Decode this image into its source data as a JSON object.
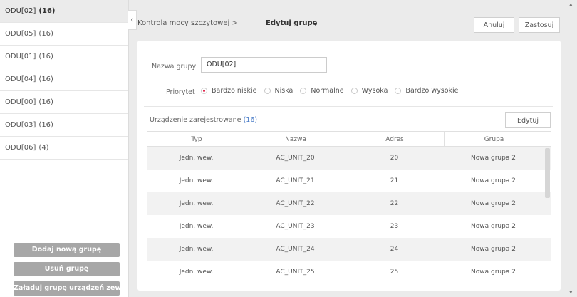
{
  "sidebar": {
    "groups": [
      {
        "name": "ODU[02]",
        "count": "(16)",
        "active": true
      },
      {
        "name": "ODU[05]",
        "count": "(16)",
        "active": false
      },
      {
        "name": "ODU[01]",
        "count": "(16)",
        "active": false
      },
      {
        "name": "ODU[04]",
        "count": "(16)",
        "active": false
      },
      {
        "name": "ODU[00]",
        "count": "(16)",
        "active": false
      },
      {
        "name": "ODU[03]",
        "count": "(16)",
        "active": false
      },
      {
        "name": "ODU[06]",
        "count": "(4)",
        "active": false
      }
    ],
    "add_group": "Dodaj nową grupę",
    "delete_group": "Usuń grupę",
    "load_external": "Załaduj grupę urządzeń zewnęt..."
  },
  "header": {
    "breadcrumb": "Kontrola mocy szczytowej >",
    "title": "Edytuj grupę",
    "cancel": "Anuluj",
    "apply": "Zastosuj"
  },
  "form": {
    "group_name_label": "Nazwa grupy",
    "group_name_value": "ODU[02]",
    "priority_label": "Priorytet",
    "priorities": [
      "Bardzo niskie",
      "Niska",
      "Normalne",
      "Wysoka",
      "Bardzo wysokie"
    ],
    "selected_priority": "Bardzo niskie"
  },
  "devices": {
    "label": "Urządzenie zarejestrowane",
    "count": "(16)",
    "edit": "Edytuj",
    "columns": [
      "Typ",
      "Nazwa",
      "Adres",
      "Grupa"
    ],
    "rows": [
      [
        "Jedn. wew.",
        "AC_UNIT_20",
        "20",
        "Nowa grupa 2"
      ],
      [
        "Jedn. wew.",
        "AC_UNIT_21",
        "21",
        "Nowa grupa 2"
      ],
      [
        "Jedn. wew.",
        "AC_UNIT_22",
        "22",
        "Nowa grupa 2"
      ],
      [
        "Jedn. wew.",
        "AC_UNIT_23",
        "23",
        "Nowa grupa 2"
      ],
      [
        "Jedn. wew.",
        "AC_UNIT_24",
        "24",
        "Nowa grupa 2"
      ],
      [
        "Jedn. wew.",
        "AC_UNIT_25",
        "25",
        "Nowa grupa 2"
      ]
    ]
  },
  "colors": {
    "accent_radio": "#e2234a",
    "count_blue": "#4a7cc7",
    "side_button": "#a7a7a7"
  },
  "icons": {
    "collapse": "chevron-left-icon"
  }
}
